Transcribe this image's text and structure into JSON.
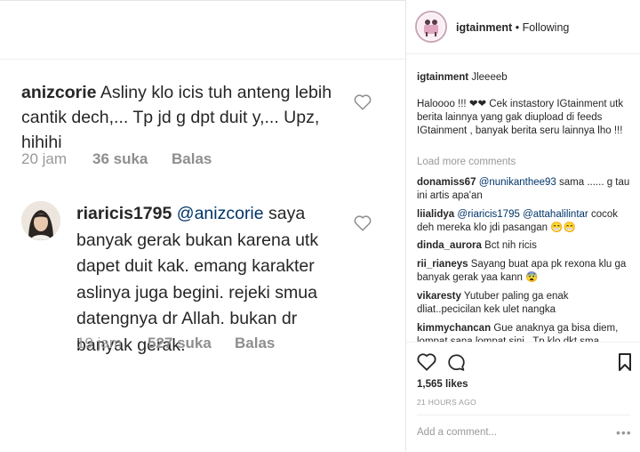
{
  "zoomed": {
    "comment1": {
      "username": "anizcorie",
      "text": "Asliny klo icis tuh anteng lebih cantik dech,... Tp jd g dpt duit y,... Upz, hihihi",
      "time": "20 jam",
      "likes": "36 suka",
      "reply": "Balas"
    },
    "comment2": {
      "username": "riaricis1795",
      "mention": "@anizcorie",
      "text": "saya banyak gerak bukan karena utk dapet duit kak. emang karakter aslinya juga begini. rejeki smua datengnya dr Allah. bukan dr banyak gerak.",
      "time": "19 jam",
      "likes": "527 suka",
      "reply": "Balas"
    }
  },
  "post": {
    "account": "igtainment",
    "separator": "•",
    "follow_status": "Following",
    "caption_user": "igtainment",
    "caption_first": "Jleeeeb",
    "caption_body": "Haloooo !!! ❤❤ Cek instastory IGtainment utk berita lainnya yang gak diupload di feeds IGtainment , banyak berita seru lainnya lho !!!",
    "load_more": "Load more comments",
    "comments": [
      {
        "user": "donamiss67",
        "mention": "@nunikanthee93",
        "text": "sama ...... g tau ini artis apa'an"
      },
      {
        "user": "liialidya",
        "mention": "@riaricis1795 @attahalilintar",
        "text": "cocok deh mereka klo jdi pasangan 😁😁"
      },
      {
        "user": "dinda_aurora",
        "mention": "",
        "text": "Bct nih ricis"
      },
      {
        "user": "rii_rianeys",
        "mention": "",
        "text": "Sayang buat apa pk rexona klu ga banyak gerak yaa kann 😨"
      },
      {
        "user": "vikaresty",
        "mention": "",
        "text": "Yutuber paling ga enak dliat..pecicilan kek ulet nangka"
      },
      {
        "user": "kimmychancan",
        "mention": "",
        "text": "Gue anaknya ga bisa diem, lompat sana lompat sini . Tp klo dkt sma"
      }
    ],
    "likes": "1,565 likes",
    "time_ago": "21 HOURS AGO",
    "add_comment_placeholder": "Add a comment...",
    "more": "•••"
  },
  "icons": [
    "heart-outline-icon",
    "comment-bubble-icon",
    "bookmark-icon",
    "more-dots-icon"
  ]
}
